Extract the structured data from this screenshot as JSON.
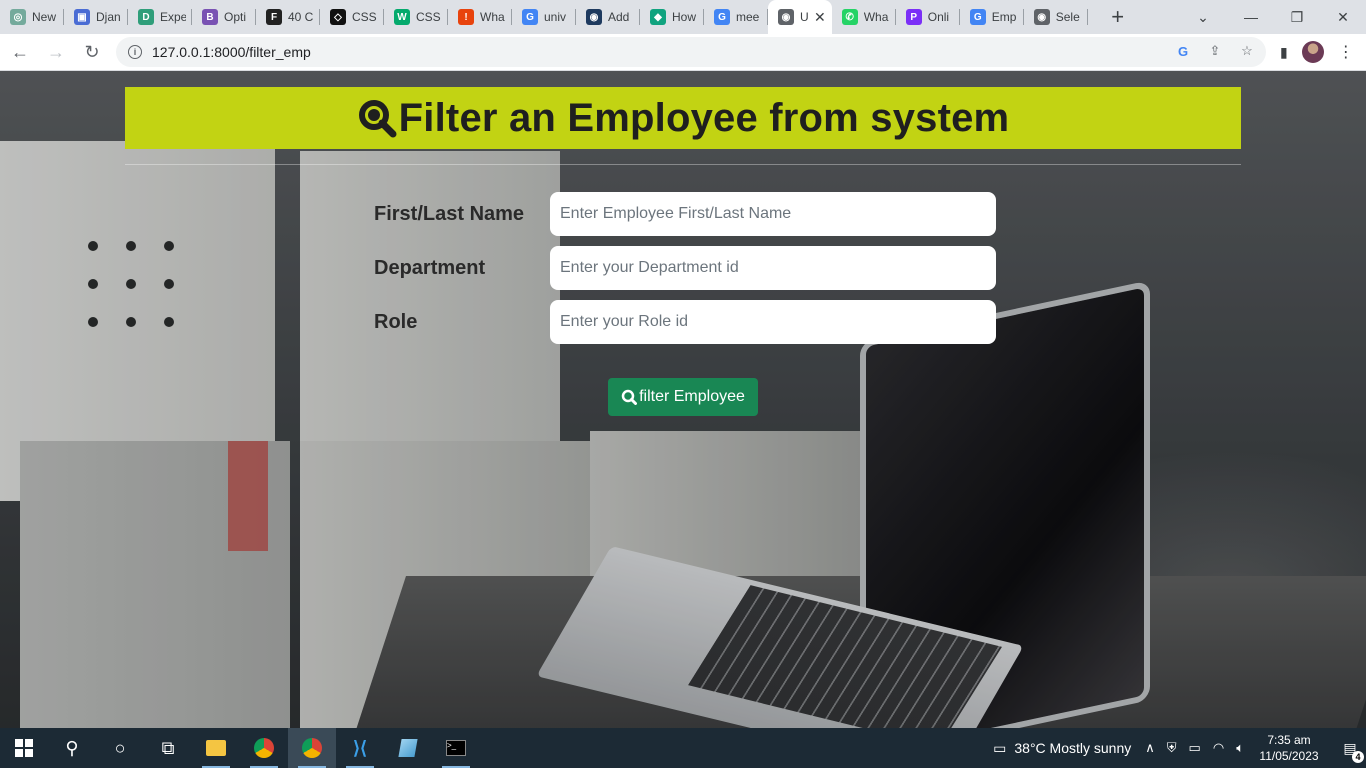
{
  "browser": {
    "tabs": [
      {
        "title": "New",
        "favicon": "chatgpt-icon",
        "color": "#74aa9c"
      },
      {
        "title": "Djan",
        "favicon": "user-icon",
        "color": "#4a6cd4"
      },
      {
        "title": "Expe",
        "favicon": "letter-d-icon",
        "color": "#2f9e7a"
      },
      {
        "title": "Opti",
        "favicon": "bootstrap-icon",
        "color": "#7952b3"
      },
      {
        "title": "40 C",
        "favicon": "f-icon",
        "color": "#222222"
      },
      {
        "title": "CSS",
        "favicon": "codepen-icon",
        "color": "#111111"
      },
      {
        "title": "CSS",
        "favicon": "w3schools-icon",
        "color": "#04aa6d"
      },
      {
        "title": "Wha",
        "favicon": "alert-icon",
        "color": "#e8430d"
      },
      {
        "title": "univ",
        "favicon": "google-icon",
        "color": "#4285f4"
      },
      {
        "title": "Add",
        "favicon": "globe-icon",
        "color": "#1e3a5f"
      },
      {
        "title": "How",
        "favicon": "chat-icon",
        "color": "#10a37f"
      },
      {
        "title": "mee",
        "favicon": "google-icon",
        "color": "#4285f4"
      },
      {
        "title": "U",
        "favicon": "globe-icon",
        "color": "#5f6368",
        "active": true
      },
      {
        "title": "Wha",
        "favicon": "whatsapp-icon",
        "color": "#25d366"
      },
      {
        "title": "Onli",
        "favicon": "p-icon",
        "color": "#7b2ff7"
      },
      {
        "title": "Emp",
        "favicon": "google-icon",
        "color": "#4285f4"
      },
      {
        "title": "Sele",
        "favicon": "globe-icon",
        "color": "#5f6368"
      }
    ],
    "new_tab_label": "+",
    "url": "127.0.0.1:8000/filter_emp"
  },
  "page": {
    "heading": "Filter an Employee from system",
    "accent_color": "#c2d313",
    "fields": {
      "name_label": "First/Last Name",
      "name_placeholder": "Enter Employee First/Last Name",
      "dept_label": "Department",
      "dept_placeholder": "Enter your Department id",
      "role_label": "Role",
      "role_placeholder": "Enter your Role id"
    },
    "submit_label": "filter Employee",
    "submit_color": "#198754"
  },
  "taskbar": {
    "weather": "38°C  Mostly sunny",
    "time": "7:35 am",
    "date": "11/05/2023",
    "notifications": "4"
  }
}
